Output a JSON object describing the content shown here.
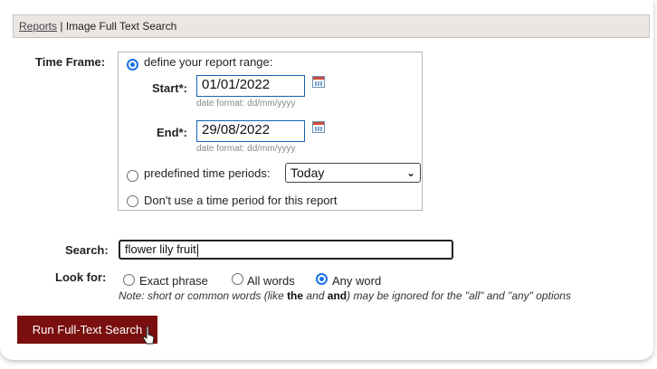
{
  "breadcrumb": {
    "link": "Reports",
    "separator": "|",
    "title": "Image Full Text Search"
  },
  "time_frame": {
    "label": "Time Frame:",
    "options": {
      "define_range": "define your report range:",
      "predefined": "predefined time periods:",
      "none": "Don't use a time period for this report"
    },
    "selected": "define_range",
    "start": {
      "label": "Start*:",
      "value": "01/01/2022",
      "hint": "date format: dd/mm/yyyy"
    },
    "end": {
      "label": "End*:",
      "value": "29/08/2022",
      "hint": "date format: dd/mm/yyyy"
    },
    "period_select": {
      "value": "Today"
    }
  },
  "search": {
    "label": "Search:",
    "value": "flower lily fruit"
  },
  "look_for": {
    "label": "Look for:",
    "options": [
      "Exact phrase",
      "All words",
      "Any word"
    ],
    "selected": "Any word",
    "note": {
      "part1": "Note: short or common words (like ",
      "word1": "the",
      "part2": " and ",
      "word2": "and",
      "part3": ") may be ignored for the \"all\" and \"any\" options"
    }
  },
  "actions": {
    "run_label": "Run Full-Text Search"
  },
  "colors": {
    "accent_blue": "#1a73e8",
    "button_bg": "#7a0f0f",
    "titlebar_bg": "#ebe6e4"
  }
}
